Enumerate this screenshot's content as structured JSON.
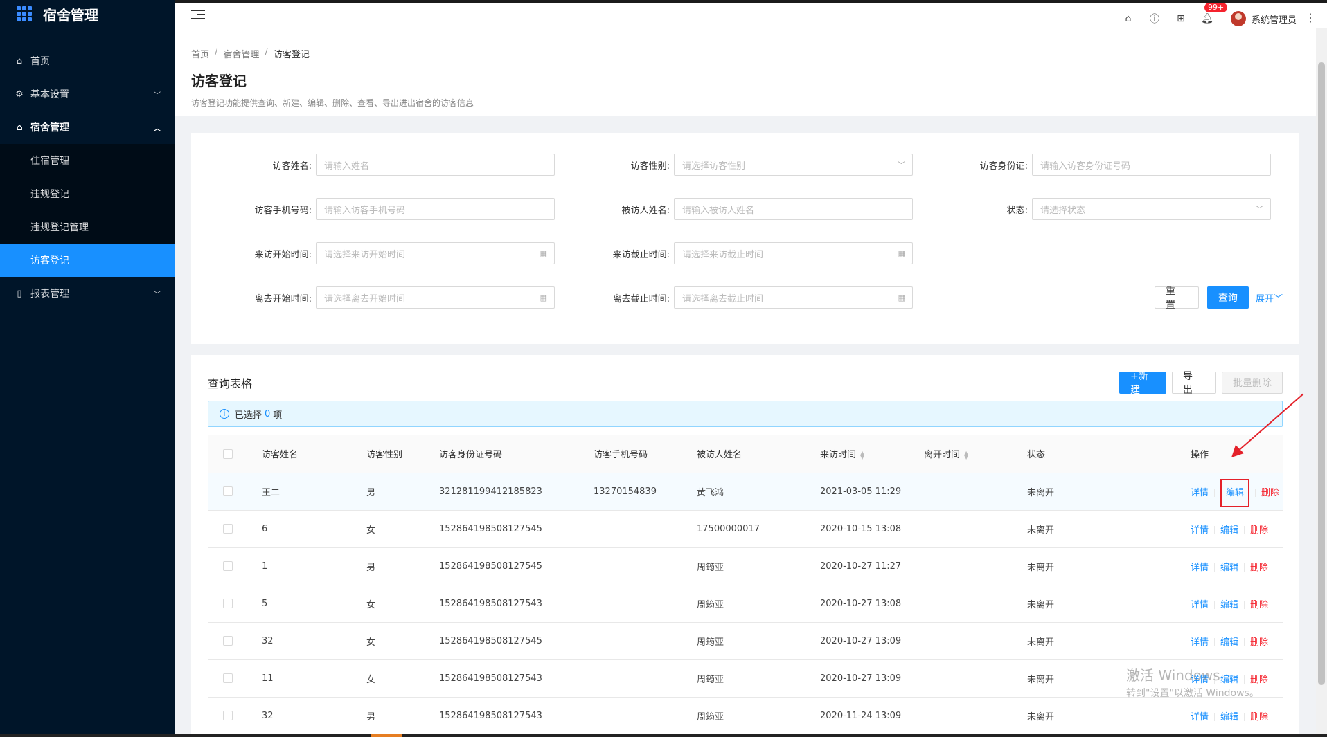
{
  "app": {
    "title": "宿舍管理"
  },
  "sidebar": {
    "items": [
      {
        "label": "首页",
        "icon": "home-icon"
      },
      {
        "label": "基本设置",
        "icon": "gear-icon"
      },
      {
        "label": "宿舍管理",
        "icon": "home-icon"
      }
    ],
    "sub": [
      {
        "label": "住宿管理"
      },
      {
        "label": "违规登记"
      },
      {
        "label": "违规登记管理"
      },
      {
        "label": "访客登记"
      }
    ],
    "report": {
      "label": "报表管理",
      "icon": "book-icon"
    }
  },
  "header": {
    "badge": "99+",
    "user": "系统管理员"
  },
  "page": {
    "breadcrumb": [
      "首页",
      "宿舍管理",
      "访客登记"
    ],
    "title": "访客登记",
    "desc": "访客登记功能提供查询、新建、编辑、删除、查看、导出进出宿舍的访客信息"
  },
  "search": {
    "name_label": "访客姓名:",
    "name_ph": "请输入姓名",
    "gender_label": "访客性别:",
    "gender_ph": "请选择访客性别",
    "id_label": "访客身份证:",
    "id_ph": "请输入访客身份证号码",
    "phone_label": "访客手机号码:",
    "phone_ph": "请输入访客手机号码",
    "visited_label": "被访人姓名:",
    "visited_ph": "请输入被访人姓名",
    "status_label": "状态:",
    "status_ph": "请选择状态",
    "vstart_label": "来访开始时间:",
    "vstart_ph": "请选择来访开始时间",
    "vend_label": "来访截止时间:",
    "vend_ph": "请选择来访截止时间",
    "lstart_label": "离去开始时间:",
    "lstart_ph": "请选择离去开始时间",
    "lend_label": "离去截止时间:",
    "lend_ph": "请选择离去截止时间",
    "reset": "重 置",
    "query": "查询",
    "expand": "展开"
  },
  "table": {
    "title": "查询表格",
    "new": "+新建",
    "export": "导 出",
    "batch_delete": "批量删除",
    "selected_prefix": "已选择",
    "selected_count": "0",
    "selected_suffix": "项",
    "columns": [
      "访客姓名",
      "访客性别",
      "访客身份证号码",
      "访客手机号码",
      "被访人姓名",
      "来访时间",
      "离开时间",
      "状态",
      "操作"
    ],
    "actions": {
      "detail": "详情",
      "edit": "编辑",
      "delete": "删除"
    },
    "rows": [
      {
        "name": "王二",
        "gender": "男",
        "idno": "321281199412185823",
        "phone": "13270154839",
        "visited": "黄飞鸿",
        "visit": "2021-03-05 11:29",
        "leave": "",
        "status": "未离开"
      },
      {
        "name": "6",
        "gender": "女",
        "idno": "152864198508127545",
        "phone": "",
        "visited": "17500000017",
        "visit": "2020-10-15 13:08",
        "leave": "",
        "status": "未离开"
      },
      {
        "name": "1",
        "gender": "男",
        "idno": "152864198508127545",
        "phone": "",
        "visited": "周筠亚",
        "visit": "2020-10-27 11:27",
        "leave": "",
        "status": "未离开"
      },
      {
        "name": "5",
        "gender": "女",
        "idno": "152864198508127543",
        "phone": "",
        "visited": "周筠亚",
        "visit": "2020-10-27 13:08",
        "leave": "",
        "status": "未离开"
      },
      {
        "name": "32",
        "gender": "女",
        "idno": "152864198508127545",
        "phone": "",
        "visited": "周筠亚",
        "visit": "2020-10-27 13:09",
        "leave": "",
        "status": "未离开"
      },
      {
        "name": "11",
        "gender": "女",
        "idno": "152864198508127543",
        "phone": "",
        "visited": "周筠亚",
        "visit": "2020-10-27 13:09",
        "leave": "",
        "status": "未离开"
      },
      {
        "name": "32",
        "gender": "男",
        "idno": "152864198508127543",
        "phone": "",
        "visited": "周筠亚",
        "visit": "2020-11-24 13:09",
        "leave": "",
        "status": "未离开"
      }
    ]
  },
  "watermark": {
    "line1": "激活 Windows",
    "line2": "转到\"设置\"以激活 Windows。"
  },
  "colors": {
    "primary": "#1890ff",
    "danger": "#f5222d",
    "sidebar": "#001529"
  }
}
